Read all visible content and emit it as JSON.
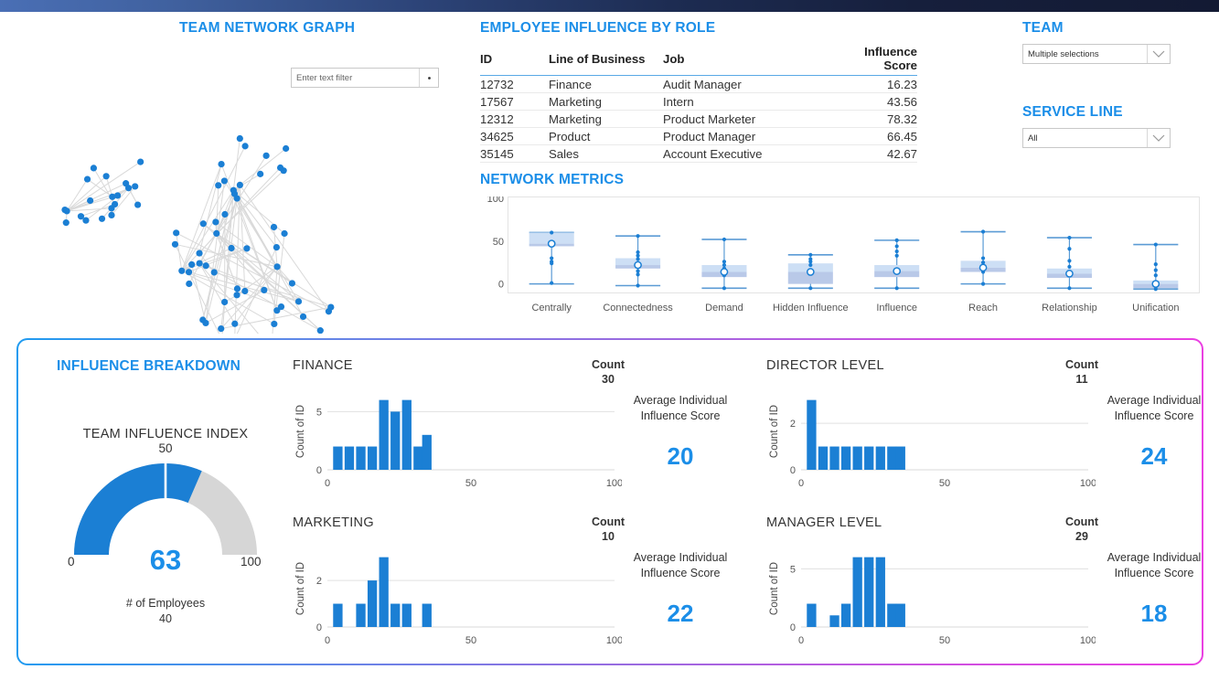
{
  "topbar": {
    "present": true
  },
  "network_graph": {
    "title": "TEAM NETWORK GRAPH",
    "filter_placeholder": "Enter text filter",
    "filter_value": "",
    "filter_button_icon": "dropdown-dot-icon",
    "node_color": "#1b7fd4",
    "edge_color": "#d9d9d9"
  },
  "employee_table": {
    "title": "EMPLOYEE INFLUENCE BY ROLE",
    "columns": [
      "ID",
      "Line of Business",
      "Job",
      "Influence Score"
    ],
    "rows": [
      {
        "id": "12732",
        "lob": "Finance",
        "job": "Audit Manager",
        "score": "16.23"
      },
      {
        "id": "17567",
        "lob": "Marketing",
        "job": "Intern",
        "score": "43.56"
      },
      {
        "id": "12312",
        "lob": "Marketing",
        "job": "Product Marketer",
        "score": "78.32"
      },
      {
        "id": "34625",
        "lob": "Product",
        "job": "Product Manager",
        "score": "66.45"
      },
      {
        "id": "35145",
        "lob": "Sales",
        "job": "Account Executive",
        "score": "42.67"
      }
    ]
  },
  "filters": {
    "team": {
      "label": "TEAM",
      "value": "Multiple selections",
      "caret": "chevron-down-icon"
    },
    "service_line": {
      "label": "SERVICE LINE",
      "value": "All",
      "caret": "chevron-down-icon"
    }
  },
  "breakdown": {
    "title": "INFLUENCE BREAKDOWN",
    "gauge": {
      "label": "TEAM INFLUENCE INDEX",
      "value": "63",
      "min": "0",
      "max": "100",
      "target": "50",
      "value_num": 63,
      "target_num": 50,
      "footer_label": "# of Employees",
      "footer_value": "40",
      "fill_color": "#1b7fd4",
      "track_color": "#d6d6d6"
    }
  },
  "chart_data": [
    {
      "type": "box",
      "title": "NETWORK METRICS",
      "ylabel": "",
      "xlabel": "",
      "ylim": [
        -10,
        100
      ],
      "yticks": [
        0,
        50,
        100
      ],
      "grid": false,
      "categories": [
        "Centrally",
        "Connectedness",
        "Demand",
        "Hidden Influence",
        "Influence",
        "Reach",
        "Relationship",
        "Unification"
      ],
      "boxes": [
        {
          "name": "Centrally",
          "min": 0,
          "q1": 44,
          "median": 47,
          "q3": 60,
          "max": 60,
          "points": [
            60,
            30,
            26,
            24,
            1
          ]
        },
        {
          "name": "Connectedness",
          "min": -2,
          "q1": 18,
          "median": 22,
          "q3": 30,
          "max": 56,
          "points": [
            56,
            37,
            33,
            29,
            22,
            15,
            11,
            -2
          ]
        },
        {
          "name": "Demand",
          "min": -5,
          "q1": 8,
          "median": 14,
          "q3": 22,
          "max": 52,
          "points": [
            52,
            26,
            22,
            18,
            14,
            10,
            -5
          ]
        },
        {
          "name": "Hidden Influence",
          "min": -5,
          "q1": 0,
          "median": 14,
          "q3": 24,
          "max": 34,
          "points": [
            34,
            29,
            26,
            22,
            14,
            -5
          ]
        },
        {
          "name": "Influence",
          "min": -5,
          "q1": 8,
          "median": 15,
          "q3": 22,
          "max": 51,
          "points": [
            51,
            44,
            38,
            33,
            15,
            -5
          ]
        },
        {
          "name": "Reach",
          "min": 0,
          "q1": 14,
          "median": 19,
          "q3": 27,
          "max": 61,
          "points": [
            61,
            30,
            25,
            19,
            14,
            0
          ]
        },
        {
          "name": "Relationship",
          "min": -5,
          "q1": 7,
          "median": 12,
          "q3": 18,
          "max": 54,
          "points": [
            54,
            41,
            27,
            20,
            12,
            -5
          ]
        },
        {
          "name": "Unification",
          "min": -6,
          "q1": -5,
          "median": 0,
          "q3": 4,
          "max": 46,
          "points": [
            46,
            23,
            16,
            10,
            0,
            -6
          ]
        }
      ],
      "box_fill": "#cddff5",
      "box_lower_fill": "#b9c9e8",
      "line_color": "#5b9bd5",
      "point_color": "#1b7fd4"
    },
    {
      "type": "bar",
      "title": "FINANCE",
      "count_label": "Count",
      "count_value": "30",
      "avg_label": "Average Individual Influence Score",
      "avg_value": "20",
      "ylabel": "Count of ID",
      "xlabel": "",
      "xlim": [
        0,
        100
      ],
      "xticks": [
        0,
        50,
        100
      ],
      "ylim": [
        0,
        6.6
      ],
      "yticks": [
        0,
        5
      ],
      "bin_starts": [
        2,
        6,
        10,
        14,
        18,
        22,
        26,
        30,
        33
      ],
      "values": [
        2,
        2,
        2,
        2,
        6,
        5,
        6,
        2,
        3
      ],
      "bar_color": "#1b7fd4"
    },
    {
      "type": "bar",
      "title": "DIRECTOR LEVEL",
      "count_label": "Count",
      "count_value": "11",
      "avg_label": "Average Individual Influence Score",
      "avg_value": "24",
      "ylabel": "Count of ID",
      "xlabel": "",
      "xlim": [
        0,
        100
      ],
      "xticks": [
        0,
        50,
        100
      ],
      "ylim": [
        0,
        3.3
      ],
      "yticks": [
        0,
        2
      ],
      "bin_starts": [
        2,
        6,
        10,
        14,
        18,
        22,
        26,
        30,
        33
      ],
      "values": [
        3,
        1,
        1,
        1,
        1,
        1,
        1,
        1,
        1
      ],
      "bar_color": "#1b7fd4"
    },
    {
      "type": "bar",
      "title": "MARKETING",
      "count_label": "Count",
      "count_value": "10",
      "avg_label": "Average Individual Influence Score",
      "avg_value": "22",
      "ylabel": "Count of ID",
      "xlabel": "",
      "xlim": [
        0,
        100
      ],
      "xticks": [
        0,
        50,
        100
      ],
      "ylim": [
        0,
        3.3
      ],
      "yticks": [
        0,
        2
      ],
      "bin_starts": [
        2,
        6,
        10,
        14,
        18,
        22,
        26,
        30,
        33
      ],
      "values": [
        1,
        0,
        1,
        2,
        3,
        1,
        1,
        0,
        1
      ],
      "bar_color": "#1b7fd4"
    },
    {
      "type": "bar",
      "title": "MANAGER LEVEL",
      "count_label": "Count",
      "count_value": "29",
      "avg_label": "Average Individual Influence Score",
      "avg_value": "18",
      "ylabel": "Count of ID",
      "xlabel": "",
      "xlim": [
        0,
        100
      ],
      "xticks": [
        0,
        50,
        100
      ],
      "ylim": [
        0,
        6.6
      ],
      "yticks": [
        0,
        5
      ],
      "bin_starts": [
        2,
        6,
        10,
        14,
        18,
        22,
        26,
        30,
        33
      ],
      "values": [
        2,
        0,
        1,
        2,
        6,
        6,
        6,
        2,
        2
      ],
      "bar_color": "#1b7fd4"
    }
  ]
}
